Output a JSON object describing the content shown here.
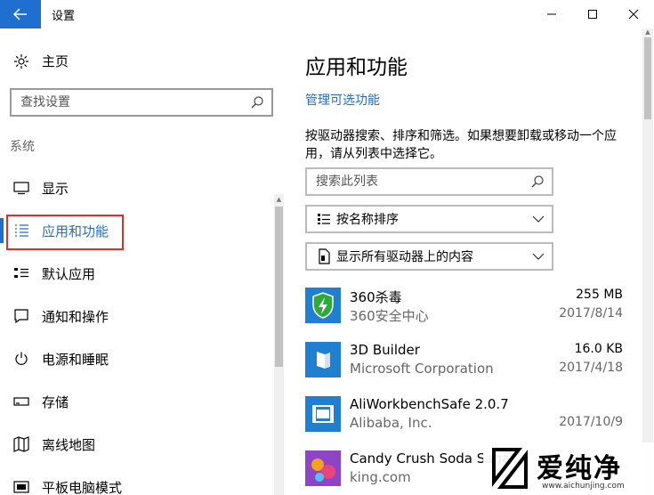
{
  "window": {
    "title": "设置",
    "controls": [
      "minimize-icon",
      "maximize-icon",
      "close-icon"
    ]
  },
  "sidebar": {
    "home_label": "主页",
    "search_placeholder": "查找设置",
    "section_label": "系统",
    "items": [
      {
        "label": "显示",
        "icon": "display-icon"
      },
      {
        "label": "应用和功能",
        "icon": "apps-list-icon",
        "active": true
      },
      {
        "label": "默认应用",
        "icon": "default-apps-icon"
      },
      {
        "label": "通知和操作",
        "icon": "notification-icon"
      },
      {
        "label": "电源和睡眠",
        "icon": "power-icon"
      },
      {
        "label": "存储",
        "icon": "storage-icon"
      },
      {
        "label": "离线地图",
        "icon": "map-icon"
      },
      {
        "label": "平板电脑模式",
        "icon": "tablet-icon"
      }
    ]
  },
  "main": {
    "title": "应用和功能",
    "manage_link": "管理可选功能",
    "description": "按驱动器搜索、排序和筛选。如果想要卸载或移动一个应用，请从列表中选择它。",
    "search_placeholder": "搜索此列表",
    "sort_label": "按名称排序",
    "filter_label": "显示所有驱动器上的内容",
    "apps": [
      {
        "name": "360杀毒",
        "publisher": "360安全中心",
        "size": "255 MB",
        "date": "2017/8/14"
      },
      {
        "name": "3D Builder",
        "publisher": "Microsoft Corporation",
        "size": "16.0 KB",
        "date": "2017/4/18"
      },
      {
        "name": "AliWorkbenchSafe 2.0.7",
        "publisher": "Alibaba, Inc.",
        "size": "",
        "date": "2017/10/9"
      },
      {
        "name": "Candy Crush Soda Saga",
        "publisher": "king.com",
        "size": "",
        "date": ""
      }
    ]
  },
  "watermark": {
    "text": "爱纯净",
    "url": "www.aichunjing.com"
  },
  "colors": {
    "accent": "#1f6fd1",
    "highlight": "#d9312b"
  }
}
